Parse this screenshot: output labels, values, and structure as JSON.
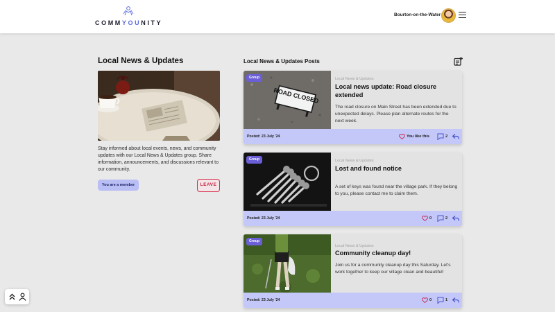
{
  "header": {
    "logo_prefix": "COMM",
    "logo_accent": "YOU",
    "logo_suffix": "NITY",
    "location": "Bourton-on-the-Water"
  },
  "group": {
    "title": "Local News & Updates",
    "description": "Stay informed about local events, news, and community updates with our Local News & Updates group. Share information, announcements, and discussions relevant to our community.",
    "member_status": "You are a member",
    "leave_label": "LEAVE"
  },
  "posts_section": {
    "title": "Local News & Updates Posts"
  },
  "posts": [
    {
      "badge": "Group",
      "group": "Local News & Updates",
      "title": "Local news update: Road closure extended",
      "text": "The road closure on Main Street has been extended due to unexpected delays. Please plan alternate routes for the next week.",
      "posted": "Posted: 23 July '24",
      "like_label": "You like this",
      "comments": "2",
      "image_sign": "ROAD CLOSED"
    },
    {
      "badge": "Group",
      "group": "Local News & Updates",
      "title": "Lost and found notice",
      "text": "A set of keys was found near the village park. If they belong to you, please contact me to claim them.",
      "posted": "Posted: 23 July '24",
      "like_label": "0",
      "comments": "2"
    },
    {
      "badge": "Group",
      "group": "Local News & Updates",
      "title": "Community cleanup day!",
      "text": "Join us for a community cleanup day this Saturday. Let's work together to keep our village clean and beautiful!",
      "posted": "Posted: 23 July '24",
      "like_label": "0",
      "comments": "1"
    }
  ],
  "colors": {
    "accent": "#5b6be0",
    "badge": "#6b5fd8",
    "footer": "#c3c8f8",
    "leave": "#d2304b",
    "heart": "#c8305a"
  },
  "icons": [
    "logo-icon",
    "menu-icon",
    "new-post-icon",
    "heart-icon",
    "heart-filled-icon",
    "comment-icon",
    "reply-icon",
    "chevrons-up-icon",
    "user-icon"
  ]
}
